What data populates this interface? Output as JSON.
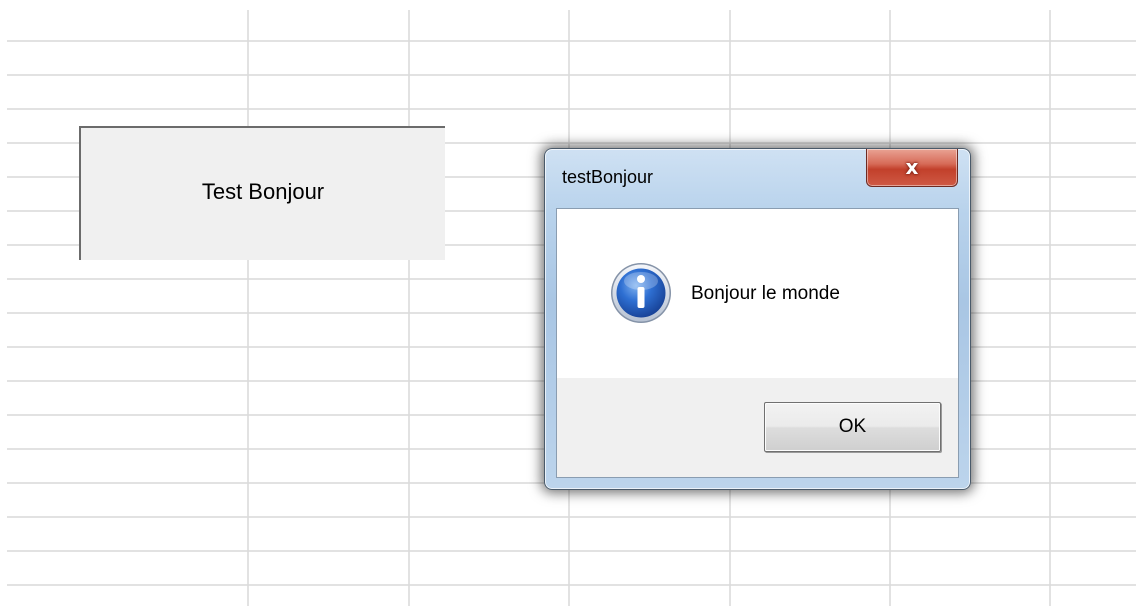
{
  "sheet_button": {
    "label": "Test Bonjour"
  },
  "dialog": {
    "title": "testBonjour",
    "close_label": "x",
    "icon": "information-icon",
    "message": "Bonjour le monde",
    "ok_label": "OK"
  },
  "colors": {
    "grid_line": "#d9d9d9",
    "button_face": "#f0f0f0",
    "close_button": "#c8432f",
    "info_icon": "#1d5fc1"
  }
}
